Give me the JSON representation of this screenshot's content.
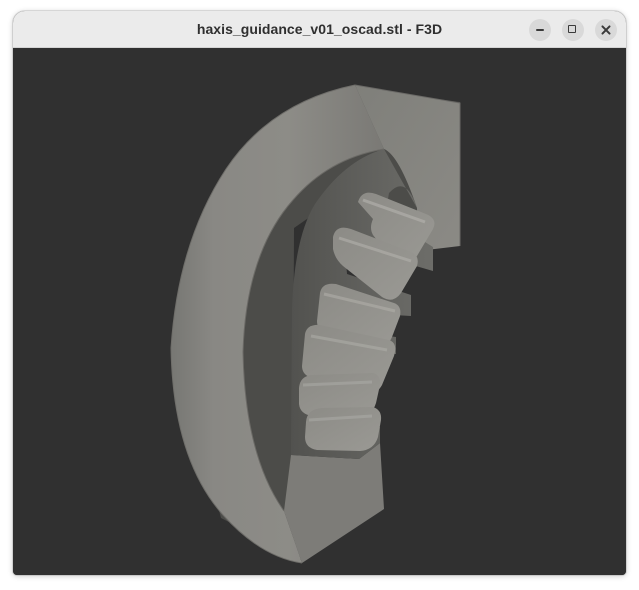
{
  "window": {
    "title": "haxis_guidance_v01_oscad.stl - F3D"
  },
  "controls": {
    "minimize_icon": "minimize-icon",
    "maximize_icon": "maximize-icon",
    "close_icon": "close-icon"
  },
  "viewport": {
    "background": "#303030",
    "model_color": "#8f8e89"
  }
}
